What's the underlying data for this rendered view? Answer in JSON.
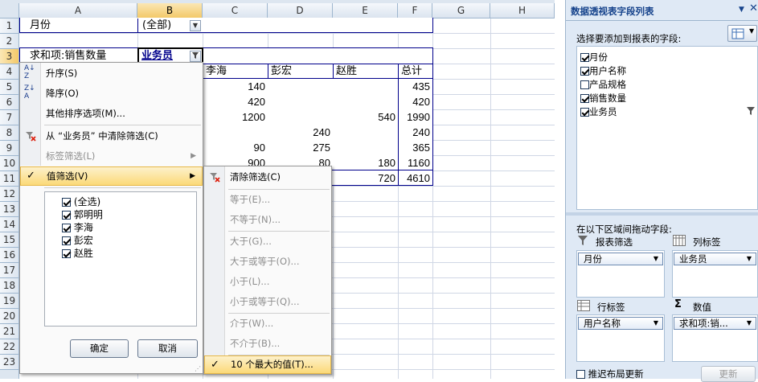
{
  "sheet": {
    "columns": [
      "A",
      "B",
      "C",
      "D",
      "E",
      "F",
      "G",
      "H"
    ],
    "rows": [
      "1",
      "2",
      "3",
      "4",
      "5",
      "6",
      "7",
      "8",
      "9",
      "10",
      "11",
      "12",
      "13",
      "14",
      "15",
      "16",
      "17",
      "18",
      "19",
      "20",
      "21",
      "22",
      "23"
    ],
    "cells": {
      "a1": "月份",
      "b1": "(全部)",
      "a3": "求和项:销售数量",
      "b3": "业务员",
      "c4": "李海",
      "d4": "彭宏",
      "e4": "赵胜",
      "f4": "总计",
      "c5": "140",
      "f5": "435",
      "c6": "420",
      "f6": "420",
      "c7": "1200",
      "e7": "540",
      "f7": "1990",
      "d8": "240",
      "f8": "240",
      "c9": "90",
      "d9": "275",
      "f9": "365",
      "c10": "900",
      "d10": "80",
      "e10": "180",
      "f10": "1160",
      "e11": "720",
      "f11": "4610"
    }
  },
  "filter_menu": {
    "sort_asc": "升序(S)",
    "sort_desc": "降序(O)",
    "more_sort": "其他排序选项(M)...",
    "clear_filter": "从 “业务员” 中清除筛选(C)",
    "label_filter": "标签筛选(L)",
    "value_filter": "值筛选(V)",
    "items": [
      {
        "label": "(全选)",
        "checked": true
      },
      {
        "label": "郭明明",
        "checked": true
      },
      {
        "label": "李海",
        "checked": true
      },
      {
        "label": "彭宏",
        "checked": true
      },
      {
        "label": "赵胜",
        "checked": true
      }
    ],
    "ok": "确定",
    "cancel": "取消"
  },
  "value_submenu": {
    "items": [
      {
        "label": "清除筛选(C)",
        "enabled": true
      },
      {
        "label": "等于(E)...",
        "enabled": false
      },
      {
        "label": "不等于(N)...",
        "enabled": false
      },
      {
        "label": "大于(G)...",
        "enabled": false
      },
      {
        "label": "大于或等于(O)...",
        "enabled": false
      },
      {
        "label": "小于(L)...",
        "enabled": false
      },
      {
        "label": "小于或等于(Q)...",
        "enabled": false
      },
      {
        "label": "介于(W)...",
        "enabled": false
      },
      {
        "label": "不介于(B)...",
        "enabled": false
      },
      {
        "label": "10 个最大的值(T)...",
        "enabled": true
      }
    ]
  },
  "pivot_panel": {
    "title": "数据透视表字段列表",
    "choose_label": "选择要添加到报表的字段:",
    "fields": [
      {
        "label": "月份",
        "checked": true
      },
      {
        "label": "用户名称",
        "checked": true
      },
      {
        "label": "产品规格",
        "checked": false
      },
      {
        "label": "销售数量",
        "checked": true
      },
      {
        "label": "业务员",
        "checked": true
      }
    ],
    "drag_label": "在以下区域间拖动字段:",
    "report_filter": "报表筛选",
    "column_labels": "列标签",
    "row_labels": "行标签",
    "values": "数值",
    "report_filter_item": "月份",
    "column_item": "业务员",
    "row_item": "用户名称",
    "value_item": "求和项:销...",
    "defer_update": "推迟布局更新",
    "update": "更新"
  },
  "colors": {
    "header_selected": "#f3c969",
    "panel_bg": "#dfe9f5",
    "pivot_border": "#00008b",
    "highlight": "#fbd978"
  }
}
